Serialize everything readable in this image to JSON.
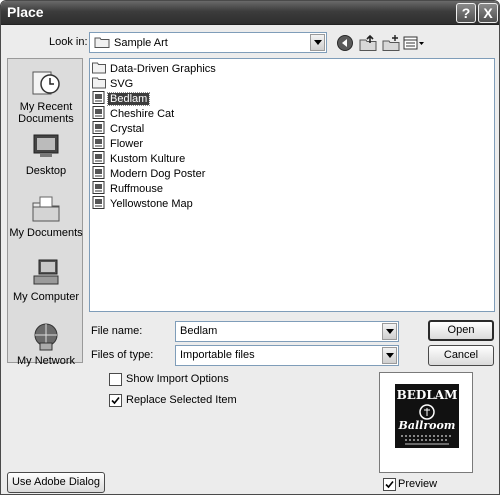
{
  "window": {
    "title": "Place"
  },
  "titlebar": {
    "help_label": "?",
    "close_label": "X"
  },
  "toolbar": {
    "lookin_label": "Look in:",
    "lookin_value": "Sample Art",
    "icons": [
      "back-icon",
      "up-folder-icon",
      "new-folder-icon",
      "view-menu-icon"
    ]
  },
  "places": [
    {
      "label": "My Recent Documents",
      "icon": "recent-documents-icon"
    },
    {
      "label": "Desktop",
      "icon": "desktop-icon"
    },
    {
      "label": "My Documents",
      "icon": "my-documents-icon"
    },
    {
      "label": "My Computer",
      "icon": "my-computer-icon"
    },
    {
      "label": "My Network",
      "icon": "my-network-icon"
    }
  ],
  "files": [
    {
      "name": "Data-Driven Graphics",
      "type": "folder"
    },
    {
      "name": "SVG",
      "type": "folder"
    },
    {
      "name": "Bedlam",
      "type": "document",
      "selected": true
    },
    {
      "name": "Cheshire Cat",
      "type": "document"
    },
    {
      "name": "Crystal",
      "type": "document"
    },
    {
      "name": "Flower",
      "type": "document"
    },
    {
      "name": "Kustom Kulture",
      "type": "document"
    },
    {
      "name": "Modern Dog Poster",
      "type": "document"
    },
    {
      "name": "Ruffmouse",
      "type": "document"
    },
    {
      "name": "Yellowstone Map",
      "type": "document"
    }
  ],
  "form": {
    "filename_label": "File name:",
    "filename_value": "Bedlam",
    "filetype_label": "Files of type:",
    "filetype_value": "Importable files"
  },
  "buttons": {
    "open": "Open",
    "cancel": "Cancel",
    "adobe_dialog": "Use Adobe Dialog"
  },
  "options": {
    "show_import_options": {
      "label": "Show Import Options",
      "checked": false
    },
    "replace_selected_item": {
      "label": "Replace Selected Item",
      "checked": true
    }
  },
  "preview": {
    "label": "Preview",
    "checked": true,
    "image_text": [
      "BEDLAM",
      "Ballroom"
    ]
  }
}
